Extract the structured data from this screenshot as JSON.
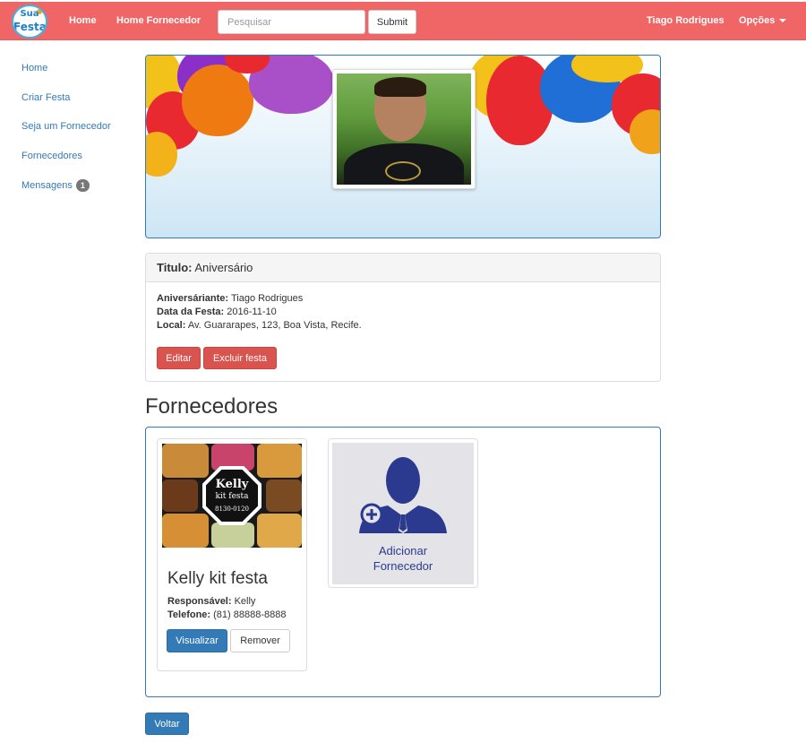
{
  "navbar": {
    "logo_line1": "Sua",
    "logo_line2": "Festa",
    "links": [
      "Home",
      "Home Fornecedor"
    ],
    "search_placeholder": "Pesquisar",
    "submit_label": "Submit",
    "user_name": "Tiago Rodrigues",
    "options_label": "Opções",
    "bar_color": "#f06565"
  },
  "sidebar": {
    "items": [
      {
        "label": "Home"
      },
      {
        "label": "Criar Festa"
      },
      {
        "label": "Seja um Fornecedor"
      },
      {
        "label": "Fornecedores"
      },
      {
        "label": "Mensagens",
        "badge": "1"
      }
    ]
  },
  "party": {
    "title_label": "Titulo:",
    "title_value": "Aniversário",
    "birthday_label": "Aniversáriante:",
    "birthday_value": "Tiago Rodrigues",
    "date_label": "Data da Festa:",
    "date_value": "2016-11-10",
    "place_label": "Local:",
    "place_value": "Av. Guararapes, 123, Boa Vista, Recife.",
    "edit_label": "Editar",
    "delete_label": "Excluir festa"
  },
  "suppliers": {
    "section_title": "Fornecedores",
    "cards": [
      {
        "logo_text_1": "Kelly",
        "logo_text_2": "kit festa",
        "logo_text_3": "8130-0120",
        "name": "Kelly kit festa",
        "responsible_label": "Responsável:",
        "responsible_value": "Kelly",
        "phone_label": "Telefone:",
        "phone_value": "(81) 88888-8888",
        "view_label": "Visualizar",
        "remove_label": "Remover"
      }
    ],
    "add_line1": "Adicionar",
    "add_line2": "Fornecedor"
  },
  "footer": {
    "back_label": "Voltar"
  },
  "colors": {
    "primary": "#337ab7",
    "danger": "#d9534f",
    "navbar": "#f06565",
    "add_icon": "#2b3a8f"
  }
}
